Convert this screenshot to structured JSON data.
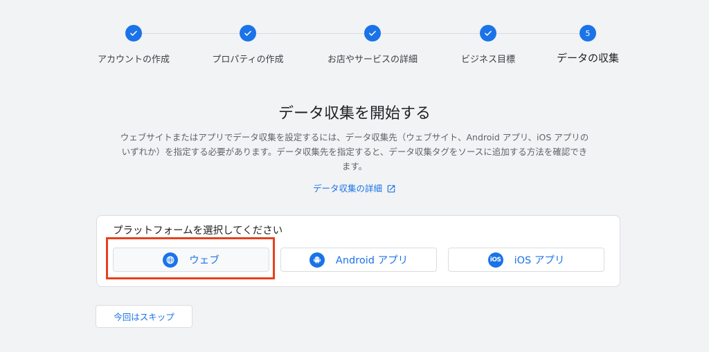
{
  "stepper": {
    "steps": [
      {
        "label": "アカウントの作成",
        "status": "done"
      },
      {
        "label": "プロパティの作成",
        "status": "done"
      },
      {
        "label": "お店やサービスの詳細",
        "status": "done"
      },
      {
        "label": "ビジネス目標",
        "status": "done"
      },
      {
        "label": "データの収集",
        "status": "active",
        "number": "5"
      }
    ]
  },
  "main": {
    "title": "データ収集を開始する",
    "description": "ウェブサイトまたはアプリでデータ収集を設定するには、データ収集先（ウェブサイト、Android アプリ、iOS アプリのいずれか）を指定する必要があります。データ収集先を指定すると、データ収集タグをソースに追加する方法を確認できます。",
    "learn_more": "データ収集の詳細"
  },
  "platform": {
    "title": "プラットフォームを選択してください",
    "options": [
      {
        "label": "ウェブ",
        "icon": "globe-icon",
        "selected": true
      },
      {
        "label": "Android アプリ",
        "icon": "android-icon",
        "selected": false
      },
      {
        "label": "iOS アプリ",
        "icon": "ios-icon",
        "icon_text": "iOS",
        "selected": false
      }
    ]
  },
  "skip_label": "今回はスキップ",
  "colors": {
    "accent": "#1a73e8",
    "highlight": "#e8401c",
    "background": "#f1f3f4"
  }
}
